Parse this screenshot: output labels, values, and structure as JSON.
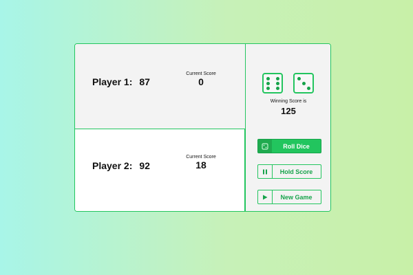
{
  "players": [
    {
      "label": "Player 1:",
      "total": "87",
      "current_label": "Current Score",
      "current": "0"
    },
    {
      "label": "Player 2:",
      "total": "92",
      "current_label": "Current Score",
      "current": "18"
    }
  ],
  "dice": [
    6,
    3
  ],
  "winning": {
    "label": "Winning Score is",
    "value": "125"
  },
  "buttons": {
    "roll": "Roll Dice",
    "hold": "Hold Score",
    "new_game": "New Game"
  },
  "colors": {
    "accent": "#22c55e",
    "accent_dark": "#16a34a",
    "panel": "#f3f3f3"
  },
  "icons": {
    "roll": "dice-icon",
    "hold": "pause-icon",
    "new_game": "play-icon"
  }
}
